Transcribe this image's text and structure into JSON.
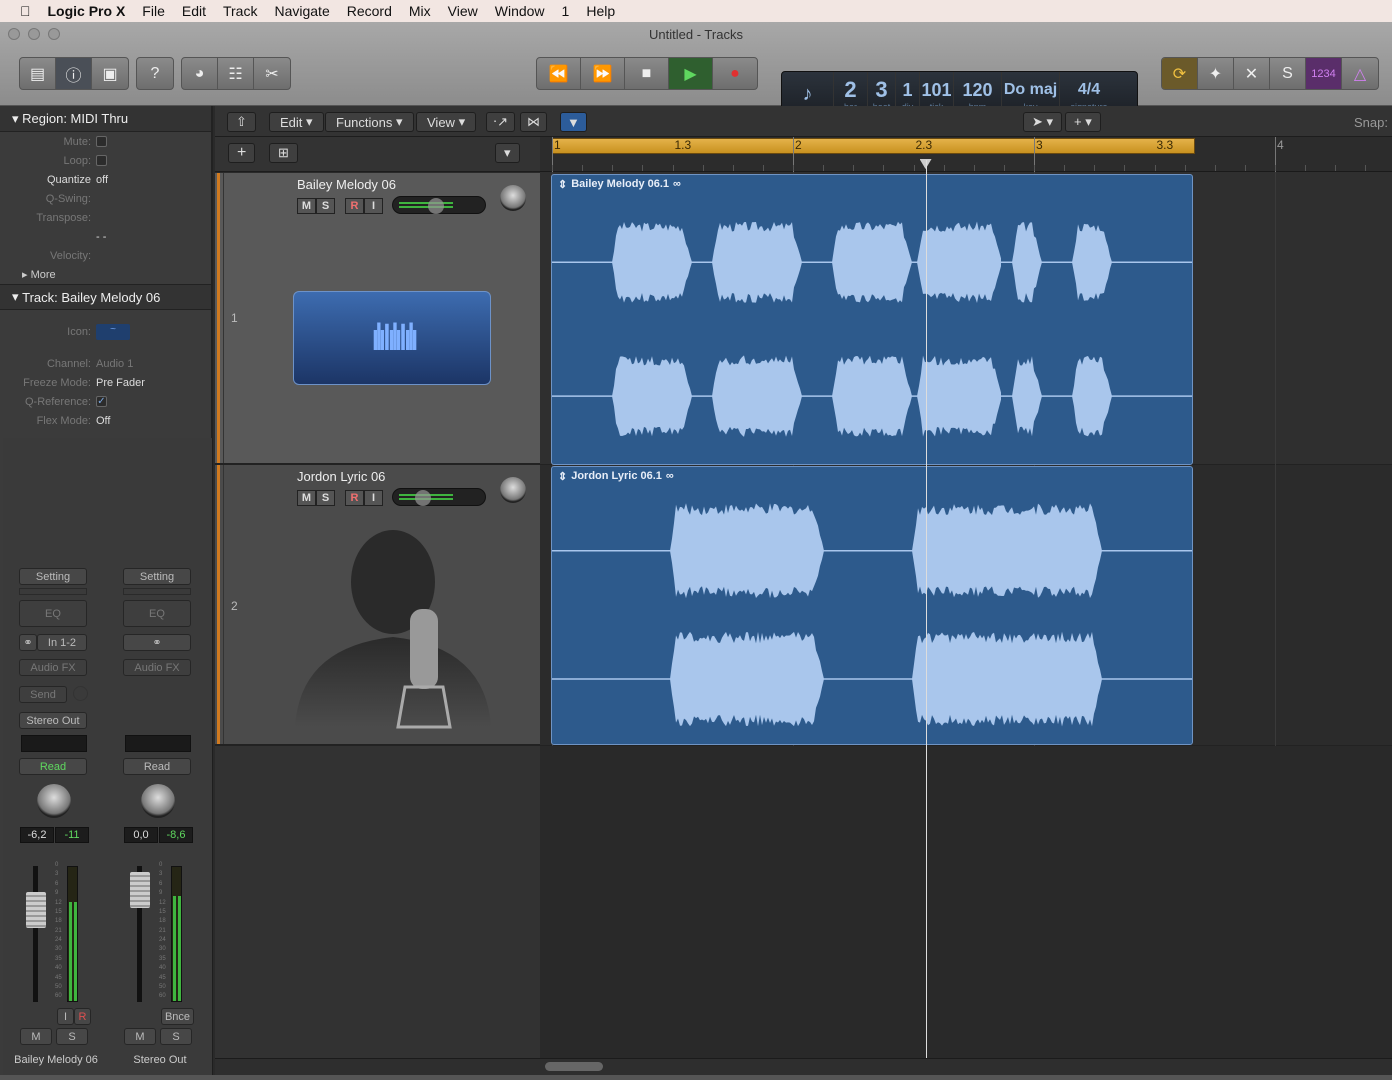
{
  "menubar": {
    "app": "Logic Pro X",
    "items": [
      "File",
      "Edit",
      "Track",
      "Navigate",
      "Record",
      "Mix",
      "View",
      "Window",
      "1",
      "Help"
    ]
  },
  "window": {
    "title": "Untitled - Tracks"
  },
  "lcd": {
    "bar": "2",
    "beat": "3",
    "div": "1",
    "tick": "101",
    "bpm": "120",
    "key": "Do maj",
    "signature": "4/4",
    "labels": {
      "bar": "bar",
      "beat": "beat",
      "div": "div",
      "tick": "tick",
      "bpm": "bpm",
      "key": "key",
      "signature": "signature"
    },
    "count_in": "1234"
  },
  "inspector": {
    "region_header": "Region: MIDI Thru",
    "region_rows": [
      {
        "k": "Mute:",
        "type": "check",
        "checked": false
      },
      {
        "k": "Loop:",
        "type": "check",
        "checked": false
      },
      {
        "k": "Quantize",
        "v": "off"
      },
      {
        "k": "Q-Swing:",
        "v": ""
      },
      {
        "k": "Transpose:",
        "v": ""
      },
      {
        "k": "",
        "v": "- -"
      },
      {
        "k": "Velocity:",
        "v": ""
      }
    ],
    "more": "More",
    "track_header": "Track:  Bailey Melody 06",
    "icon_label": "Icon:",
    "track_rows": [
      {
        "k": "Channel:",
        "v": "Audio 1",
        "dim": true
      },
      {
        "k": "Freeze Mode:",
        "v": "Pre Fader"
      },
      {
        "k": "Q-Reference:",
        "type": "check",
        "checked": true
      },
      {
        "k": "Flex Mode:",
        "v": "Off"
      }
    ]
  },
  "strips": [
    {
      "setting": "Setting",
      "eq": "EQ",
      "input": "In 1-2",
      "fx": "Audio FX",
      "send": "Send",
      "output": "Stereo Out",
      "automation": "Read",
      "vol": "-6,2",
      "peak": "-11",
      "i": "I",
      "r": "R",
      "m": "M",
      "s": "S",
      "name": "Bailey Melody 06",
      "fader_db": -6.2,
      "meter_level_db": -15
    },
    {
      "setting": "Setting",
      "eq": "EQ",
      "input": "",
      "fx": "Audio FX",
      "automation": "Read",
      "vol": "0,0",
      "peak": "-8,6",
      "bnce": "Bnce",
      "m": "M",
      "s": "S",
      "name": "Stereo Out",
      "fader_db": 0,
      "meter_level_db": -12
    }
  ],
  "meter_scale": [
    "0",
    "3",
    "6",
    "9",
    "12",
    "15",
    "18",
    "21",
    "24",
    "30",
    "35",
    "40",
    "45",
    "50",
    "60"
  ],
  "tracks_toolbar": {
    "edit": "Edit",
    "functions": "Functions",
    "view": "View",
    "snap": "Snap:"
  },
  "ruler": {
    "labels": [
      {
        "t": "1",
        "bar": 1
      },
      {
        "t": "1.3",
        "bar": 1.5
      },
      {
        "t": "2",
        "bar": 2
      },
      {
        "t": "2.3",
        "bar": 2.5
      },
      {
        "t": "3",
        "bar": 3
      },
      {
        "t": "3.3",
        "bar": 3.5
      },
      {
        "t": "4",
        "bar": 4
      }
    ],
    "cycle": [
      1,
      3.67
    ],
    "playhead_bar": 2.55
  },
  "tracks": [
    {
      "num": "1",
      "name": "Bailey Melody 06",
      "m": "M",
      "s": "S",
      "r": "R",
      "i": "I",
      "region": "Bailey Melody 06.1",
      "selected": true
    },
    {
      "num": "2",
      "name": "Jordon Lyric 06",
      "m": "M",
      "s": "S",
      "r": "R",
      "i": "I",
      "region": "Jordon Lyric 06.1",
      "selected": false
    }
  ],
  "colors": {
    "region": "#2d5a8c",
    "waveform": "#a9c6ec",
    "cycle": "#d9a33a",
    "green": "#3fb43f",
    "record": "#e05050"
  }
}
